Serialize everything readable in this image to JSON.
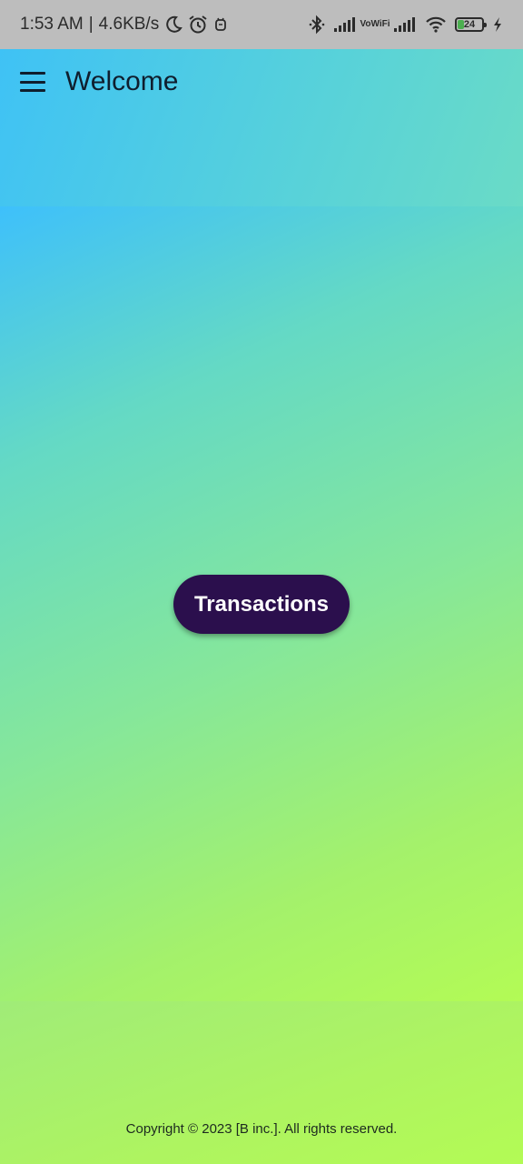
{
  "status_bar": {
    "time": "1:53 AM",
    "separator": "|",
    "network_speed": "4.6KB/s",
    "left_icons": [
      "moon-icon",
      "alarm-icon",
      "notification-icon"
    ],
    "right_icons": [
      "bluetooth-icon",
      "signal-icon",
      "vowifi-icon",
      "signal-icon",
      "wifi-icon",
      "battery-icon",
      "charging-icon"
    ],
    "vowifi_top": "Vo",
    "vowifi_bottom": "WiFi",
    "battery_level": "24",
    "battery_color": "#4caf50"
  },
  "app_bar": {
    "menu_icon": "menu-icon",
    "title": "Welcome"
  },
  "main": {
    "transactions_button": "Transactions",
    "button_color": "#2b0f4d"
  },
  "footer": {
    "copyright": "Copyright © 2023 [B inc.]. All rights reserved."
  },
  "colors": {
    "gradient_start": "#3ec0fb",
    "gradient_end": "#b3fb55"
  }
}
